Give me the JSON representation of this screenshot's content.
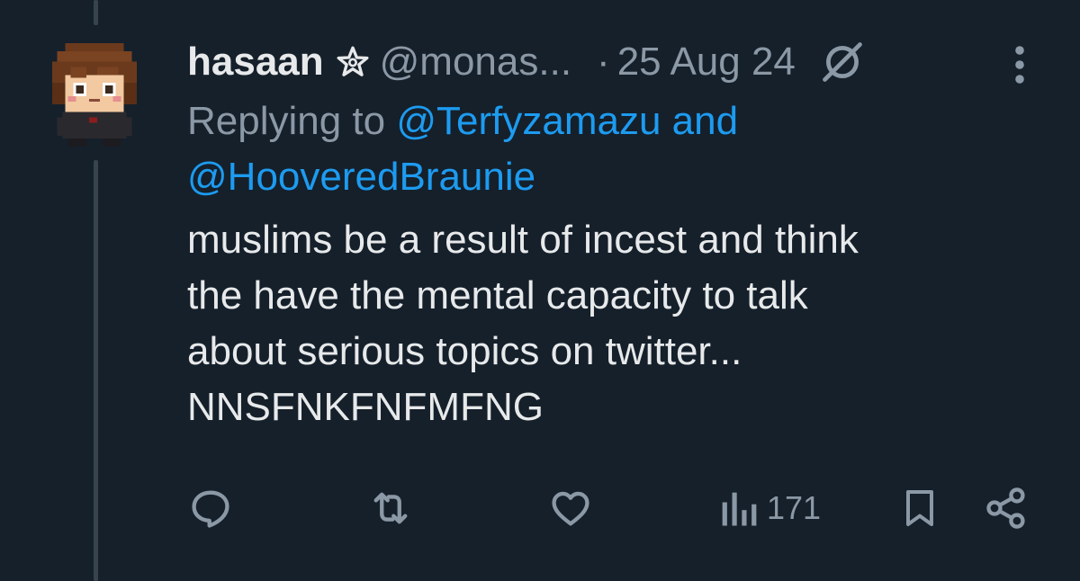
{
  "tweet": {
    "author": {
      "display_name": "hasaan",
      "handle": "@monas...",
      "badge_icon": "star-outline-icon",
      "avatar_icon": "pixel-art-avatar"
    },
    "separator": "·",
    "date": "25 Aug 24",
    "reply_prefix": "Replying to ",
    "reply_mentions": [
      "@Terfyzamazu",
      "@HooveredBraunie"
    ],
    "reply_conjunction": " and",
    "text": "muslims be a result of incest and think\nthe have the mental capacity to talk\nabout serious topics on twitter...\nNNSFNKFNFMFNG",
    "stats": {
      "views": "171"
    }
  },
  "actions": {
    "reply_icon": "reply-icon",
    "retweet_icon": "retweet-icon",
    "like_icon": "heart-icon",
    "views_icon": "views-chart-icon",
    "bookmark_icon": "bookmark-icon",
    "share_icon": "share-icon"
  },
  "colors": {
    "background": "#15202b",
    "primary_text": "#e7e9ea",
    "secondary_text": "#8b98a5",
    "link": "#1d9bf0",
    "thread_line": "#38444d"
  }
}
